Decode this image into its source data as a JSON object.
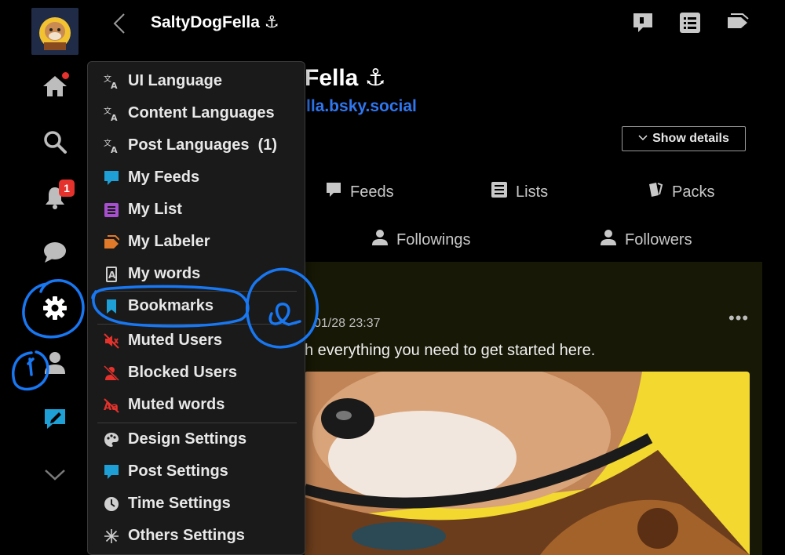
{
  "header": {
    "title": "SaltyDogFella ⚓",
    "back_icon": "chevron-left-icon",
    "actions": [
      {
        "icon": "feed-icon"
      },
      {
        "icon": "list-icon"
      },
      {
        "icon": "label-icon"
      }
    ]
  },
  "sidebar": {
    "items": [
      {
        "icon": "home-icon",
        "has_dot": true
      },
      {
        "icon": "search-icon"
      },
      {
        "icon": "bell-icon",
        "badge": "1"
      },
      {
        "icon": "chat-icon"
      },
      {
        "icon": "gear-icon"
      },
      {
        "icon": "person-icon"
      },
      {
        "icon": "compose-icon"
      },
      {
        "icon": "chevron-down-icon"
      }
    ]
  },
  "profile": {
    "name": "Fella ⚓",
    "handle": "lla.bsky.social",
    "show_details": "Show details"
  },
  "tabs": {
    "feeds": "Feeds",
    "lists": "Lists",
    "packs": "Packs",
    "followings": "Followings",
    "followers": "Followers"
  },
  "post": {
    "time": "01/28 23:37",
    "more": "•••",
    "text": "h everything you need to get started here."
  },
  "menu": {
    "items": [
      {
        "label": "UI Language",
        "icon": "translate-icon",
        "color": "#d0d0d0"
      },
      {
        "label": "Content Languages",
        "icon": "translate-icon",
        "color": "#d0d0d0"
      },
      {
        "label": "Post Languages",
        "count": "(1)",
        "icon": "translate-icon",
        "color": "#d0d0d0"
      },
      {
        "label": "My Feeds",
        "icon": "feed-icon",
        "color": "#1ea0d6"
      },
      {
        "label": "My List",
        "icon": "list-icon",
        "color": "#a64fcf"
      },
      {
        "label": "My Labeler",
        "icon": "label-icon",
        "color": "#e07a2a"
      },
      {
        "label": "My words",
        "icon": "word-icon",
        "color": "#d0d0d0"
      },
      {
        "label": "Bookmarks",
        "icon": "bookmark-icon",
        "color": "#1ea0d6"
      },
      {
        "label": "Muted Users",
        "icon": "mute-icon",
        "color": "#e5322c"
      },
      {
        "label": "Blocked Users",
        "icon": "block-user-icon",
        "color": "#e5322c"
      },
      {
        "label": "Muted words",
        "icon": "muted-words-icon",
        "color": "#e5322c"
      },
      {
        "label": "Design Settings",
        "icon": "palette-icon",
        "color": "#d0d0d0"
      },
      {
        "label": "Post Settings",
        "icon": "chat-bubble-icon",
        "color": "#1ea0d6"
      },
      {
        "label": "Time Settings",
        "icon": "clock-icon",
        "color": "#d0d0d0"
      },
      {
        "label": "Others Settings",
        "icon": "asterisk-icon",
        "color": "#d0d0d0"
      }
    ]
  },
  "annotations": {
    "mark1": "1",
    "mark2": "2",
    "ink_color": "#1877f2"
  },
  "colors": {
    "accent_blue": "#2f77f0",
    "badge_red": "#e5322c",
    "compose_teal": "#1ea0d6"
  }
}
